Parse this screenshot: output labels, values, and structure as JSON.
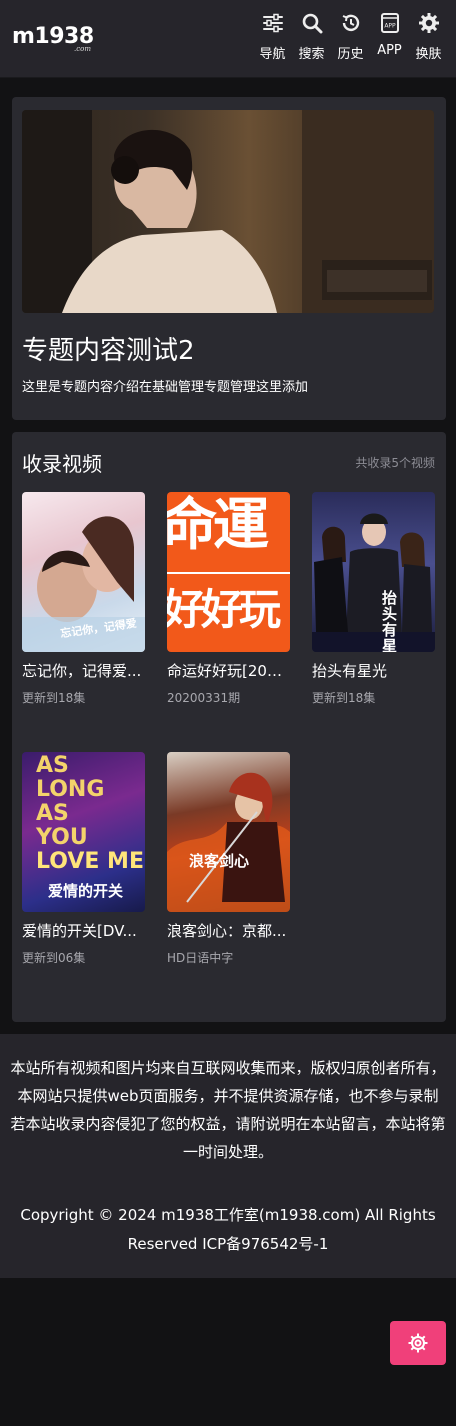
{
  "header": {
    "logo_main": "m1938",
    "logo_sub": ".com",
    "nav": [
      {
        "label": "导航",
        "icon": "sliders-icon"
      },
      {
        "label": "搜索",
        "icon": "search-icon"
      },
      {
        "label": "历史",
        "icon": "history-icon"
      },
      {
        "label": "APP",
        "icon": "app-icon"
      },
      {
        "label": "换肤",
        "icon": "gear-icon"
      }
    ],
    "app_icon_text": "APP"
  },
  "topic": {
    "title": "专题内容测试2",
    "description": "这里是专题内容介绍在基础管理专题管理这里添加"
  },
  "videos": {
    "section_title": "收录视频",
    "count_text": "共收录5个视频",
    "items": [
      {
        "name": "忘记你，记得爱...",
        "sub": "更新到18集"
      },
      {
        "name": "命运好好玩[202...",
        "sub": "20200331期"
      },
      {
        "name": "抬头有星光",
        "sub": "更新到18集"
      },
      {
        "name": "爱情的开关[DV...",
        "sub": "更新到06集"
      },
      {
        "name": "浪客剑心：京都...",
        "sub": "HD日语中字"
      }
    ],
    "poster_text": {
      "p1": "忘记你，记得爱",
      "p2_top": "命運",
      "p2_bottom": "好好玩",
      "p3": "抬头有星光",
      "p4_lines": [
        "AS",
        "LONG",
        "AS",
        "YOU",
        "LOVE ME"
      ],
      "p4_cn": "爱情的开关",
      "p5": "浪客剑心"
    }
  },
  "footer": {
    "notice_line1": "本站所有视频和图片均来自互联网收集而来，版权归原创者所有，本网站只提供web页面服务，并不提供资源存储，也不参与录制",
    "notice_line2": "若本站收录内容侵犯了您的权益，请附说明在本站留言，本站将第一时间处理。",
    "copyright": "Copyright © 2024 m1938工作室(m1938.com) All Rights Reserved ICP备976542号-1"
  },
  "colors": {
    "header_bg": "#26252b",
    "card_bg": "#2a2a30",
    "page_bg": "#121214",
    "accent": "#f0407a",
    "muted": "#8c8c94"
  },
  "float_button": {
    "icon": "gear-icon"
  }
}
